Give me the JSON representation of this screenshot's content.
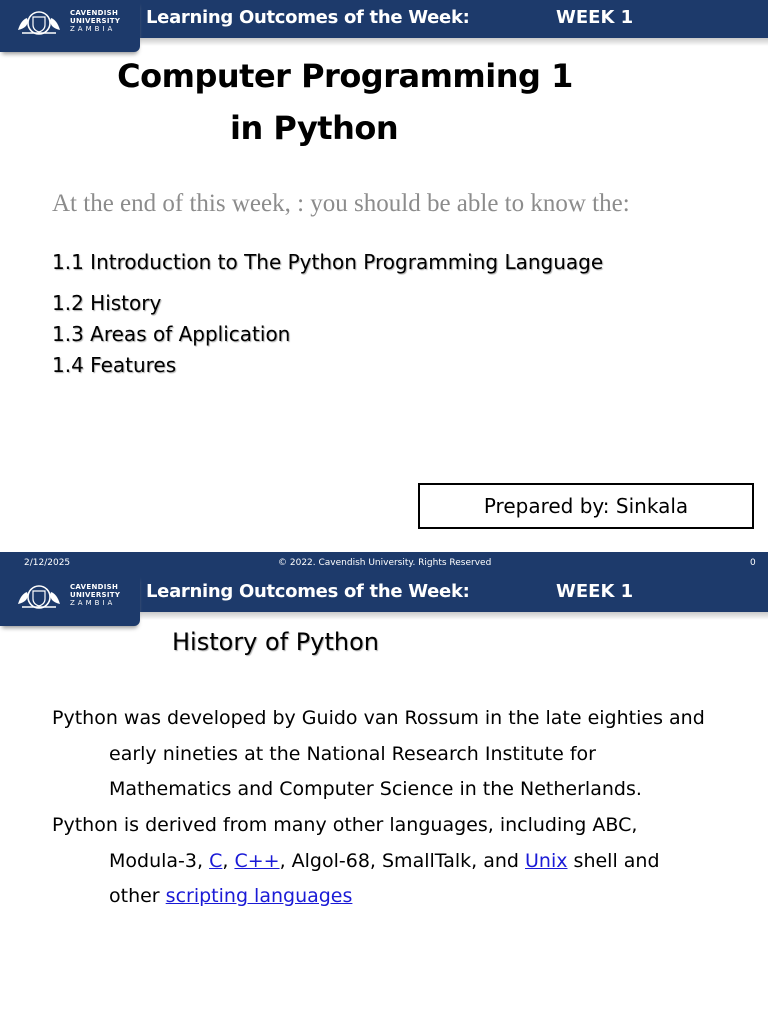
{
  "header": {
    "university_line1": "CAVENDISH",
    "university_line2": "UNIVERSITY",
    "university_line3": "ZAMBIA",
    "title": "Learning Outcomes of the Week:",
    "week": "WEEK 1"
  },
  "slide1": {
    "title_line1": "Computer Programming 1",
    "title_line2": "in Python",
    "intro": "At the end of this week, : you should be able to know the:",
    "topics": [
      "1.1 Introduction to The Python Programming Language",
      "1.2 History",
      "1.3 Areas of Application",
      "1.4 Features"
    ],
    "prepared_by": "Prepared by: Sinkala"
  },
  "footer": {
    "date": "2/12/2025",
    "copyright": "© 2022. Cavendish University. Rights Reserved",
    "page_number": "0"
  },
  "slide2": {
    "title": "History of Python",
    "para1": [
      "Python was developed by Guido van Rossum in the late eighties and",
      "early nineties at the National Research Institute for",
      "Mathematics and Computer Science in the Netherlands."
    ],
    "para2_line1": "Python is derived from many other languages, including ABC,",
    "para2_line2_a": "Modula-3, ",
    "link_c": "C",
    "sep1": ", ",
    "link_cpp": "C++",
    "para2_line2_b": ", Algol-68, SmallTalk, and ",
    "link_unix": "Unix",
    "para2_line2_c": " shell and",
    "para2_line3_a": "other ",
    "link_scripting": "scripting languages"
  },
  "colors": {
    "header_blue": "#1d3a6b",
    "link_blue": "#1a1ad6",
    "intro_gray": "#8c8c8c"
  }
}
